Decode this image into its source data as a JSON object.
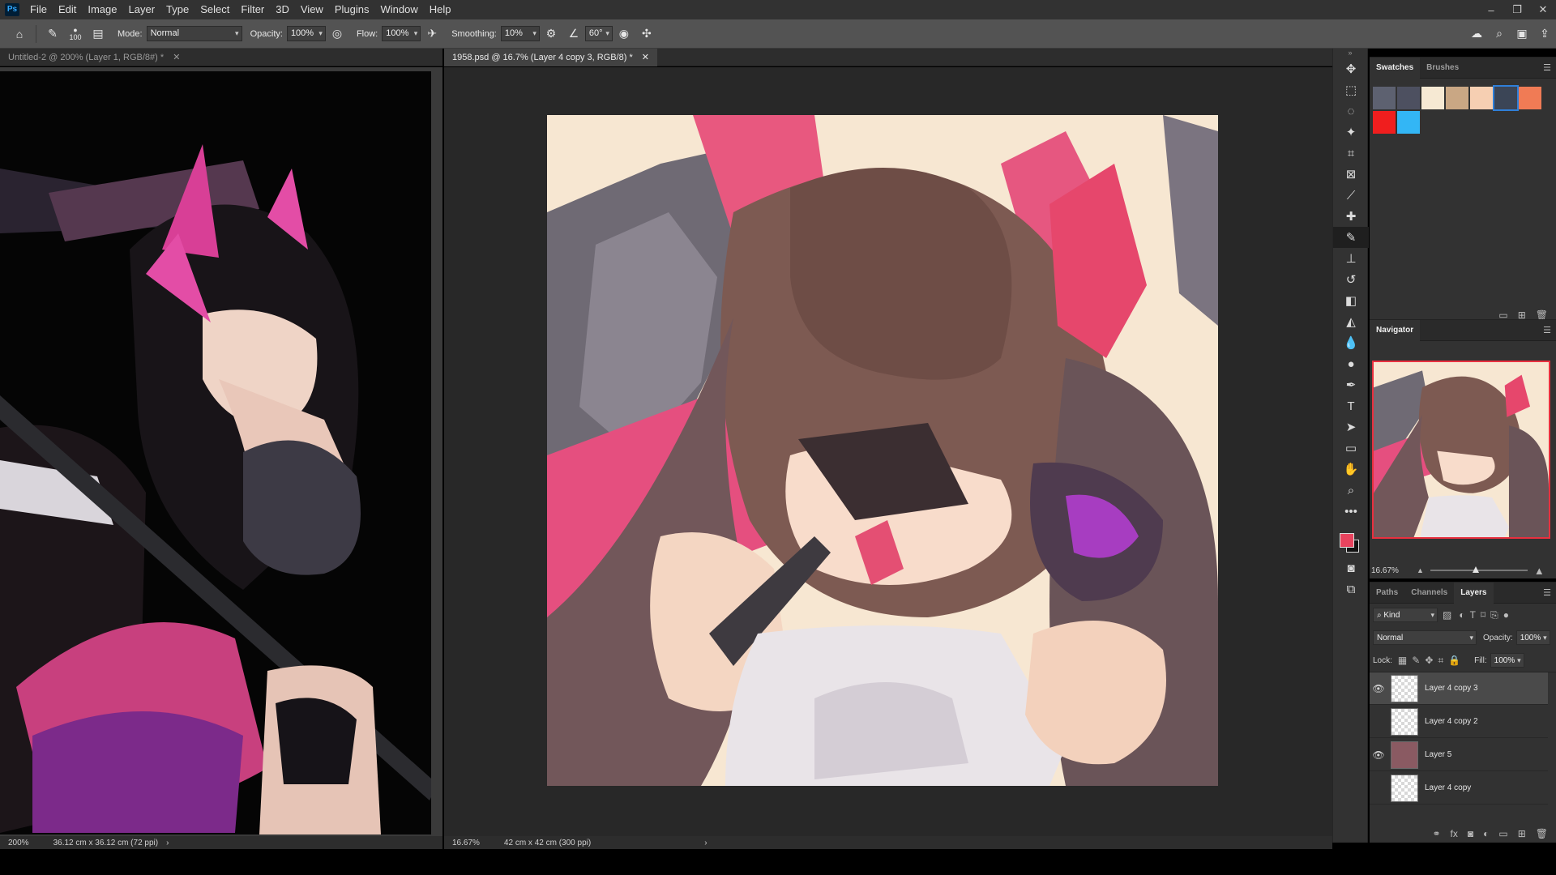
{
  "app": {
    "logo": "Ps"
  },
  "menu": [
    "File",
    "Edit",
    "Image",
    "Layer",
    "Type",
    "Select",
    "Filter",
    "3D",
    "View",
    "Plugins",
    "Window",
    "Help"
  ],
  "window_controls": {
    "minimize": "–",
    "restore": "❐",
    "close": "✕"
  },
  "options": {
    "brush_size": "100",
    "mode_label": "Mode:",
    "mode_value": "Normal",
    "opacity_label": "Opacity:",
    "opacity_value": "100%",
    "flow_label": "Flow:",
    "flow_value": "100%",
    "smoothing_label": "Smoothing:",
    "smoothing_value": "10%",
    "angle_value": "60°"
  },
  "documents": [
    {
      "tab": "Untitled-2 @ 200% (Layer 1, RGB/8#) *",
      "zoom": "200%",
      "size": "36.12 cm x 36.12 cm (72 ppi)"
    },
    {
      "tab": "1958.psd @ 16.7% (Layer 4 copy 3, RGB/8) *",
      "zoom": "16.67%",
      "size": "42 cm x 42 cm (300 ppi)"
    }
  ],
  "swatches_panel": {
    "tabs": [
      "Swatches",
      "Brushes"
    ],
    "colors": [
      "#5d6170",
      "#4d5060",
      "#f6e9d3",
      "#c9a784",
      "#f6cfb2",
      "#3b4556",
      "#f07b55",
      "#f01e1e",
      "#33b6f5"
    ]
  },
  "navigator": {
    "title": "Navigator",
    "zoom": "16.67%"
  },
  "layers_panel": {
    "tabs": [
      "Paths",
      "Channels",
      "Layers"
    ],
    "filter": "Kind",
    "blend_mode": "Normal",
    "opacity_label": "Opacity:",
    "opacity_value": "100%",
    "lock_label": "Lock:",
    "fill_label": "Fill:",
    "fill_value": "100%",
    "layers": [
      {
        "name": "Layer 4 copy 3",
        "visible": true,
        "selected": true
      },
      {
        "name": "Layer 4 copy 2",
        "visible": false,
        "selected": false
      },
      {
        "name": "Layer 5",
        "visible": true,
        "selected": false
      },
      {
        "name": "Layer 4 copy",
        "visible": false,
        "selected": false
      }
    ]
  },
  "colors": {
    "foreground": "#e8435e",
    "background": "#111111",
    "nav_frame": "#e8303f"
  }
}
